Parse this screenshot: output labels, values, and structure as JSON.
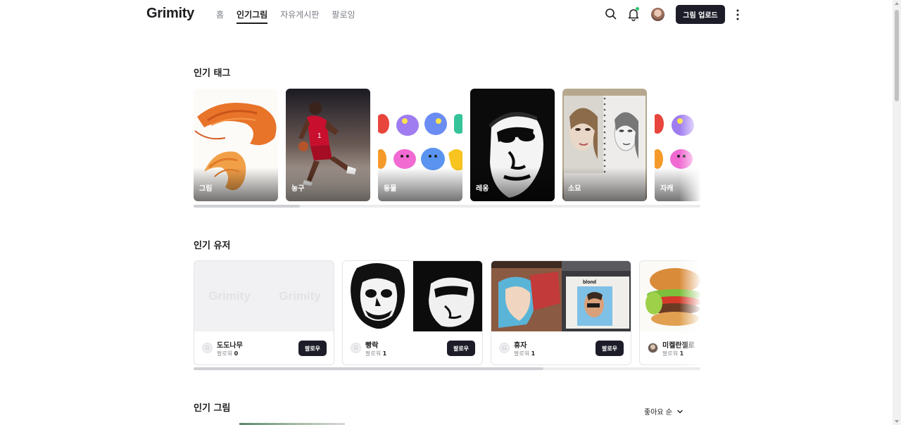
{
  "header": {
    "logo": "Grimity",
    "nav": [
      {
        "label": "홈",
        "active": false
      },
      {
        "label": "인기그림",
        "active": true
      },
      {
        "label": "자유게시판",
        "active": false
      },
      {
        "label": "팔로잉",
        "active": false
      }
    ],
    "upload_label": "그림 업로드",
    "icons": [
      "search-icon",
      "bell-icon",
      "avatar",
      "more-icon"
    ],
    "notification_dot_color": "#26c46a"
  },
  "popular_tags": {
    "title": "인기 태그",
    "tags": [
      {
        "label": "그림"
      },
      {
        "label": "농구"
      },
      {
        "label": "동물"
      },
      {
        "label": "레옹"
      },
      {
        "label": "소묘"
      },
      {
        "label": "자캐"
      }
    ],
    "scroll_progress": 0.21
  },
  "popular_users": {
    "title": "인기 유저",
    "follow_label": "팔로우",
    "followers_label": "팔로워",
    "placeholder_logo": "Grimity",
    "users": [
      {
        "name": "도도나무",
        "followers": "0",
        "initial": "G"
      },
      {
        "name": "빵락",
        "followers": "1",
        "initial": "G"
      },
      {
        "name": "휴자",
        "followers": "1",
        "initial": "G"
      },
      {
        "name": "미켈란젤로",
        "followers": "1",
        "initial": ""
      }
    ],
    "scroll_progress": 0.69
  },
  "popular_art": {
    "title": "인기 그림",
    "sort_label": "좋아요 순"
  },
  "colors": {
    "primary": "#1d1d2a",
    "text": "#1d1d20",
    "muted": "#7a7d85",
    "border": "#e3e4e8"
  }
}
